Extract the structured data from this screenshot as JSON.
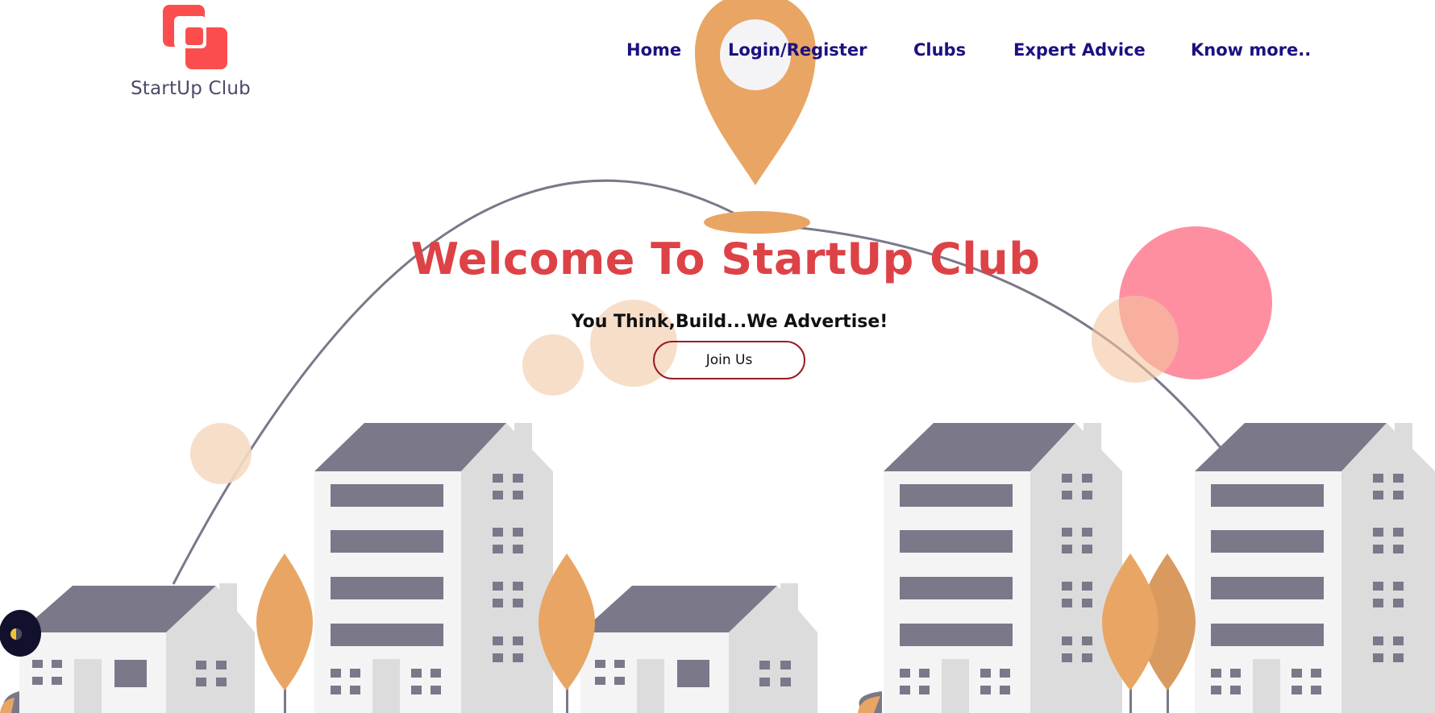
{
  "brand": {
    "name": "StartUp Club",
    "accent": "#fb4d4d",
    "text_color": "#4a4a68"
  },
  "nav": {
    "color": "#1c1180",
    "items": [
      {
        "label": "Home"
      },
      {
        "label": "Login/Register"
      },
      {
        "label": "Clubs"
      },
      {
        "label": "Expert Advice"
      },
      {
        "label": "Know more.."
      }
    ]
  },
  "hero": {
    "title": "Welcome To StartUp Club",
    "subtitle": "You Think,Build...We Advertise!",
    "cta_label": "Join Us",
    "title_color": "#dd4247"
  },
  "illustration": {
    "palette": {
      "pin": "#e8a564",
      "arc": "#7a7889",
      "building_light": "#f4f4f5",
      "building_side": "#dcdcdd",
      "roof": "#7a7889",
      "tree": "#e8a564",
      "bubble_peach": "#f6dac3",
      "bubble_pink": "#fe8fa1"
    }
  },
  "theme_toggle": {
    "icon": "half-sun-icon"
  }
}
